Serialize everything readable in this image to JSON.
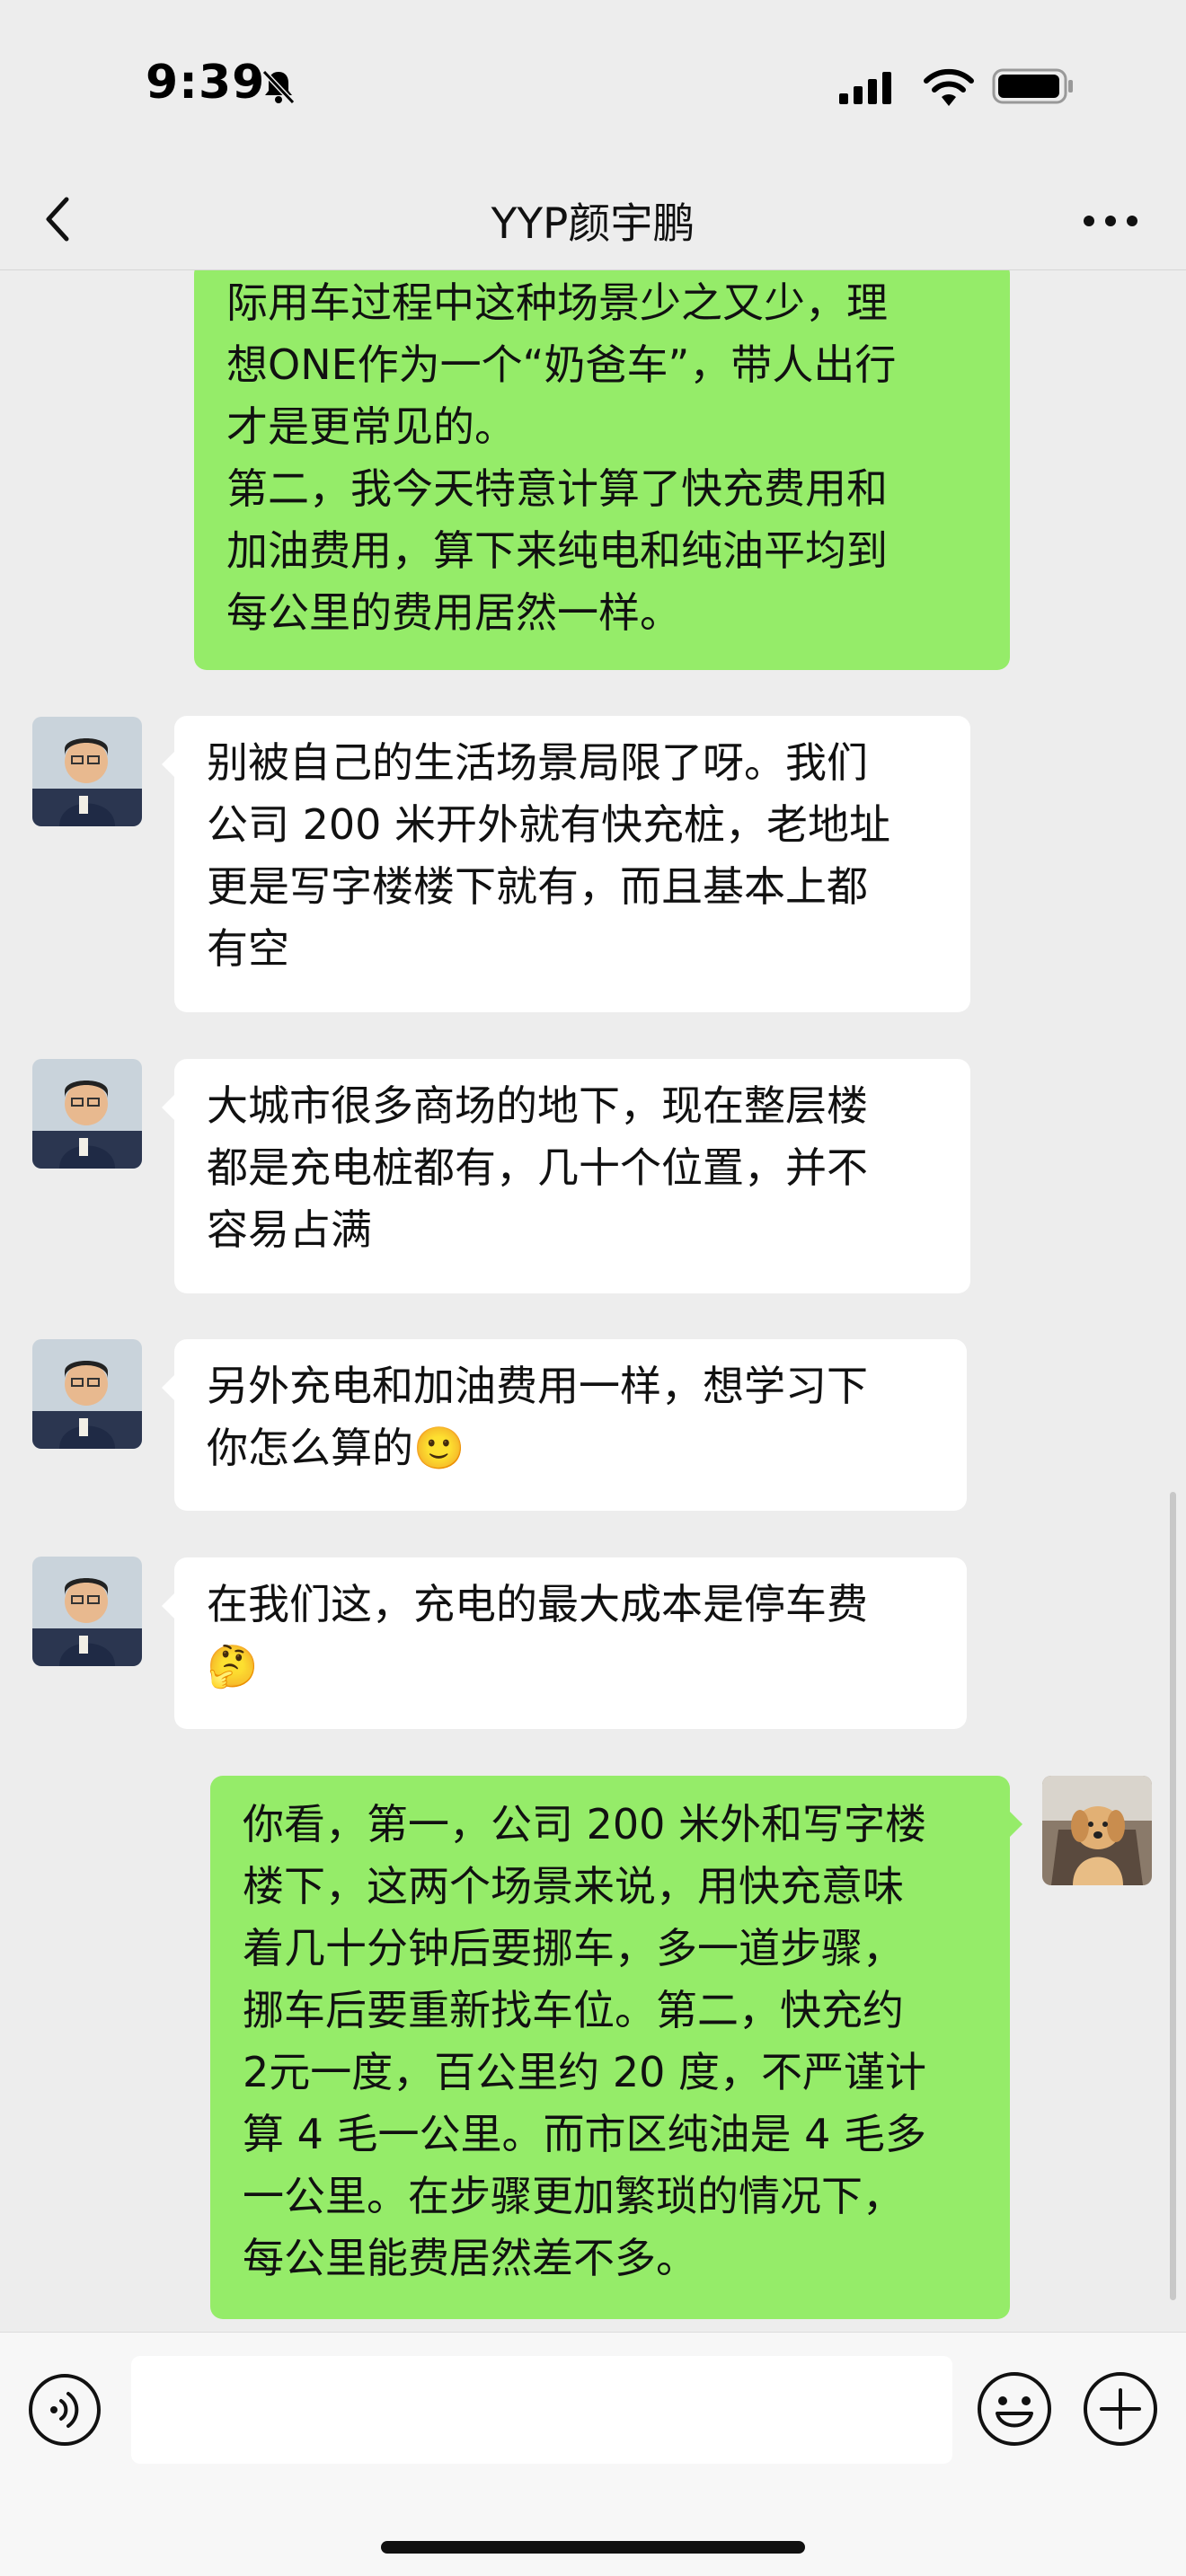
{
  "status_bar": {
    "time": "9:39"
  },
  "header": {
    "title": "YYP颜宇鹏"
  },
  "icons": {
    "back": "chevron-left-icon",
    "more": "more-icon",
    "voice": "voice-icon",
    "emoji": "emoji-icon",
    "plus": "plus-icon"
  },
  "colors": {
    "outgoing_bubble": "#95ec69",
    "incoming_bubble": "#ffffff",
    "background": "#ededed"
  },
  "messages": [
    {
      "sender": "me",
      "lines": [
        "际用车过程中这种场景少之又少，理",
        "想ONE作为一个“奶爸车”，带人出行",
        "才是更常见的。",
        "第二，我今天特意计算了快充费用和",
        "加油费用，算下来纯电和纯油平均到",
        "每公里的费用居然一样。"
      ]
    },
    {
      "sender": "YYP颜宇鹏",
      "lines": [
        "别被自己的生活场景局限了呀。我们",
        "公司 200 米开外就有快充桩，老地址",
        "更是写字楼楼下就有，而且基本上都",
        "有空"
      ]
    },
    {
      "sender": "YYP颜宇鹏",
      "lines": [
        "大城市很多商场的地下，现在整层楼",
        "都是充电桩都有，几十个位置，并不",
        "容易占满"
      ]
    },
    {
      "sender": "YYP颜宇鹏",
      "lines": [
        "另外充电和加油费用一样，想学习下",
        "你怎么算的🙂"
      ]
    },
    {
      "sender": "YYP颜宇鹏",
      "lines": [
        "在我们这，充电的最大成本是停车费",
        "🤔"
      ]
    },
    {
      "sender": "me",
      "lines": [
        "你看，第一，公司 200 米外和写字楼",
        "楼下，这两个场景来说，用快充意味",
        "着几十分钟后要挪车，多一道步骤，",
        "挪车后要重新找车位。第二，快充约",
        "2元一度，百公里约 20 度，不严谨计",
        "算 4 毛一公里。而市区纯油是 4 毛多",
        "一公里。在步骤更加繁琐的情况下，",
        "每公里能费居然差不多。"
      ]
    }
  ],
  "input": {
    "placeholder": ""
  }
}
